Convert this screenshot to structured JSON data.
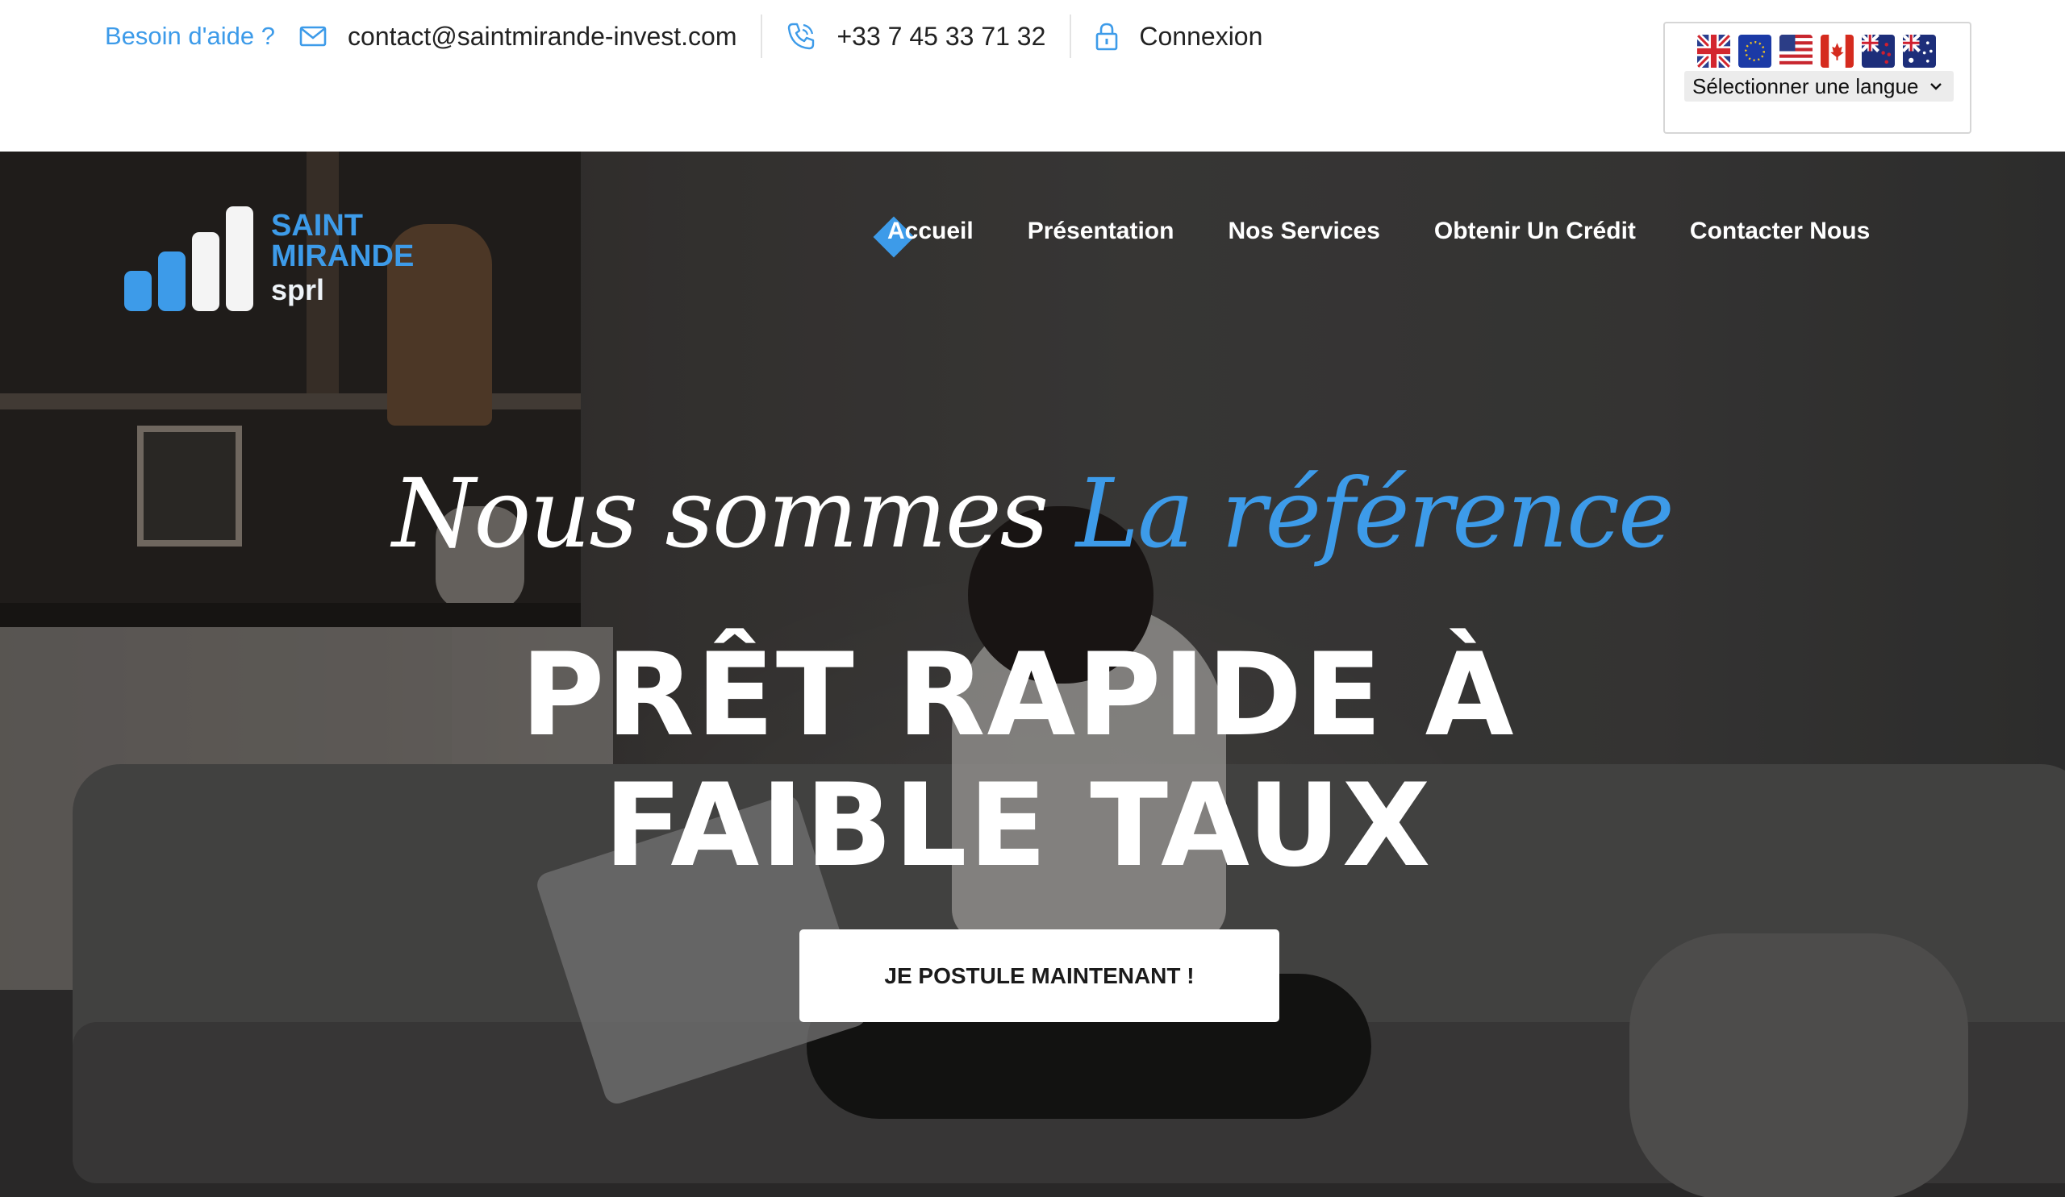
{
  "topbar": {
    "help_text": "Besoin d'aide ?",
    "email": "contact@saintmirande-invest.com",
    "phone": "+33 7 45 33 71 32",
    "login": "Connexion",
    "icons": [
      "mail-icon",
      "phone-icon",
      "lock-icon"
    ]
  },
  "language": {
    "select_label": "Sélectionner une langue",
    "flags": [
      "uk-flag",
      "eu-flag",
      "us-flag",
      "canada-flag",
      "new-zealand-flag",
      "australia-flag"
    ]
  },
  "logo": {
    "line1": "SAINT",
    "line2": "MIRANDE",
    "line3": "sprl"
  },
  "nav": {
    "items": [
      {
        "label": "Accueil",
        "active": true
      },
      {
        "label": "Présentation"
      },
      {
        "label": "Nos Services"
      },
      {
        "label": "Obtenir Un Crédit"
      },
      {
        "label": "Contacter Nous"
      }
    ]
  },
  "hero": {
    "script_text": "Nous sommes",
    "script_accent": "La référence",
    "headline_line1": "PRÊT RAPIDE À",
    "headline_line2": "FAIBLE TAUX",
    "cta": "JE POSTULE MAINTENANT !"
  },
  "colors": {
    "accent": "#3d9be9",
    "text_dark": "#222222",
    "white": "#ffffff"
  }
}
